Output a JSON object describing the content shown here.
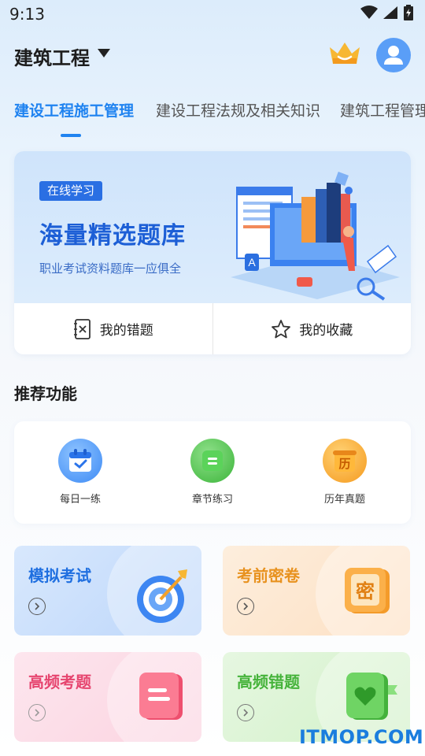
{
  "status": {
    "time": "9:13"
  },
  "header": {
    "title": "建筑工程"
  },
  "tabs": [
    {
      "label": "建设工程施工管理"
    },
    {
      "label": "建设工程法规及相关知识"
    },
    {
      "label": "建筑工程管理"
    }
  ],
  "banner": {
    "badge": "在线学习",
    "title": "海量精选题库",
    "subtitle": "职业考试资料题库一应俱全"
  },
  "quick": {
    "wrong": "我的错题",
    "favorites": "我的收藏"
  },
  "section": {
    "title": "推荐功能"
  },
  "features": [
    {
      "label": "每日一练",
      "icon": "calendar-check-icon"
    },
    {
      "label": "章节练习",
      "icon": "list-icon"
    },
    {
      "label": "历年真题",
      "icon": "scroll-icon"
    }
  ],
  "cards": [
    {
      "title": "模拟考试",
      "icon": "target-icon",
      "color": "#1f6fe0"
    },
    {
      "title": "考前密卷",
      "icon": "secret-paper-icon",
      "color": "#e8921f"
    },
    {
      "title": "高频考题",
      "icon": "paper-icon",
      "color": "#e6456f"
    },
    {
      "title": "高频错题",
      "icon": "heart-book-icon",
      "color": "#45b33a"
    }
  ],
  "watermark": "ITMOP.COM"
}
